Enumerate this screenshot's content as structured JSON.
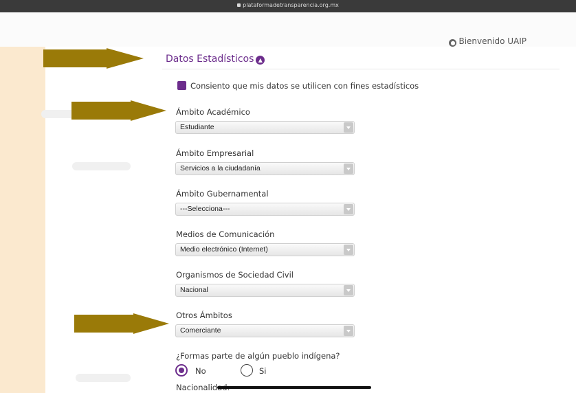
{
  "browser": {
    "url": "plataformadetransparencia.org.mx"
  },
  "header": {
    "welcome": "Bienvenido UAIP"
  },
  "section": {
    "title": "Datos Estadísticos",
    "consent_label": "Consiento que mis datos se utilicen con fines estadísticos",
    "consent_checked": true
  },
  "fields": [
    {
      "label": "Ámbito Académico",
      "value": "Estudiante"
    },
    {
      "label": "Ámbito Empresarial",
      "value": "Servicios a la ciudadanía"
    },
    {
      "label": "Ámbito Gubernamental",
      "value": "---Selecciona---"
    },
    {
      "label": "Medios de Comunicación",
      "value": "Medio electrónico (Internet)"
    },
    {
      "label": "Organismos de Sociedad Civil",
      "value": "Nacional"
    },
    {
      "label": "Otros Ámbitos",
      "value": "Comerciante"
    }
  ],
  "indigenous": {
    "question": "¿Formas parte de algún pueblo indígena?",
    "options": [
      {
        "label": "No",
        "selected": true
      },
      {
        "label": "Si",
        "selected": false
      }
    ]
  },
  "nationality": {
    "label": "Nacionalidad:"
  },
  "colors": {
    "accent": "#6c2d8c",
    "arrow": "#9a7a08"
  }
}
